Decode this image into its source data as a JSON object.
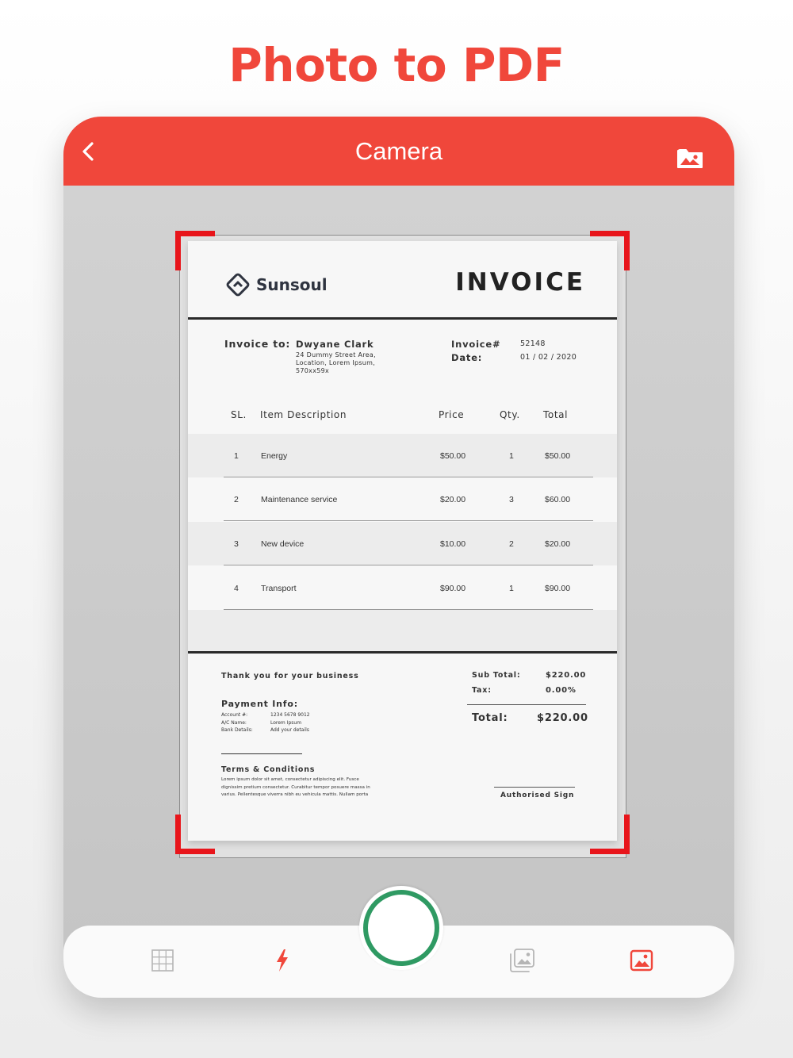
{
  "headline": "Photo to PDF",
  "colors": {
    "accent": "#f0473b",
    "shutter_ring": "#2f9a63",
    "corner_marker": "#e8151b",
    "icon_gray": "#b5b5b5"
  },
  "topbar": {
    "title": "Camera",
    "back_icon": "chevron-left-icon",
    "right_icon": "folder-image-icon"
  },
  "invoice": {
    "brand": "Sunsoul",
    "title": "INVOICE",
    "invoice_to_label": "Invoice to:",
    "client_name": "Dwyane Clark",
    "client_address": [
      "24 Dummy Street Area,",
      "Location, Lorem Ipsum,",
      "570xx59x"
    ],
    "invoice_no_label": "Invoice#",
    "invoice_no": "52148",
    "date_label": "Date:",
    "date": "01 / 02 / 2020",
    "columns": [
      "SL.",
      "Item Description",
      "Price",
      "Qty.",
      "Total"
    ],
    "items": [
      {
        "sl": "1",
        "desc": "Energy",
        "price": "$50.00",
        "qty": "1",
        "total": "$50.00"
      },
      {
        "sl": "2",
        "desc": "Maintenance service",
        "price": "$20.00",
        "qty": "3",
        "total": "$60.00"
      },
      {
        "sl": "3",
        "desc": "New device",
        "price": "$10.00",
        "qty": "2",
        "total": "$20.00"
      },
      {
        "sl": "4",
        "desc": "Transport",
        "price": "$90.00",
        "qty": "1",
        "total": "$90.00"
      }
    ],
    "thanks": "Thank you for your business",
    "payment_label": "Payment Info:",
    "payment": [
      {
        "label": "Account #:",
        "value": "1234 5678 9012"
      },
      {
        "label": "A/C Name:",
        "value": "Lorem Ipsum"
      },
      {
        "label": "Bank Details:",
        "value": "Add your details"
      }
    ],
    "terms_label": "Terms & Conditions",
    "terms_lines": [
      "Lorem ipsum dolor sit amet, consectetur adipiscing elit. Fusce",
      "dignissim pretium consectetur. Curabitur tempor posuere massa in",
      "varius. Pellentesque viverra nibh eu vehicula mattis. Nullam porta"
    ],
    "subtotal_label": "Sub Total:",
    "subtotal": "$220.00",
    "tax_label": "Tax:",
    "tax": "0.00%",
    "total_label": "Total:",
    "total": "$220.00",
    "sign_label": "Authorised Sign"
  },
  "toolbar": {
    "grid_icon": "grid-icon",
    "flash_icon": "flash-icon",
    "shutter": "shutter-button",
    "gallery_icon": "gallery-icon",
    "image_icon": "image-icon"
  }
}
